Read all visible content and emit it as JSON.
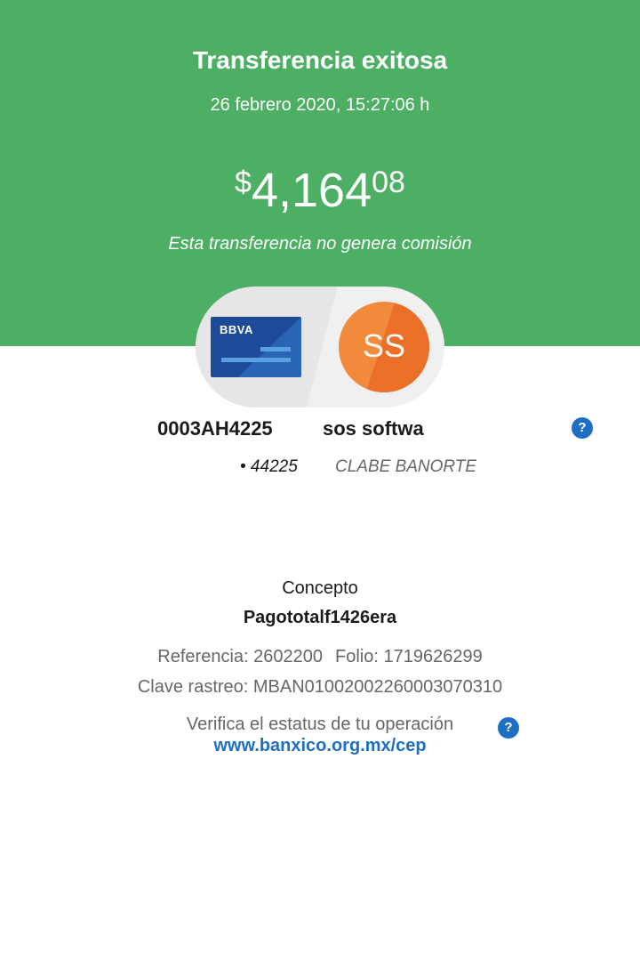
{
  "header": {
    "title": "Transferencia exitosa",
    "datetime": "26 febrero 2020, 15:27:06 h",
    "amount": {
      "currency": "$",
      "integer": "4,164",
      "decimals": "08"
    },
    "commission_note": "Esta transferencia no genera comisión",
    "background_color": "#4caf64"
  },
  "source_card": {
    "bank_logo": "BBVA",
    "icon": "bank-card-icon"
  },
  "recipient": {
    "initials": "SS",
    "account_id": "0003AH4225",
    "name": "sos softwa",
    "account_mask": "• 44225",
    "account_type": "CLABE BANORTE",
    "help_icon": "?"
  },
  "details": {
    "concept_label": "Concepto",
    "concept_value": "Pagototalf1426era",
    "reference": "Referencia: 2602200",
    "folio": "Folio: 1719626299",
    "tracking_key": "Clave rastreo: MBAN01002002260003070310",
    "verify_text": "Verifica el estatus de tu operación",
    "verify_link": "www.banxico.org.mx/cep",
    "help_icon": "?"
  },
  "colors": {
    "accent": "#1e6fc4",
    "avatar": "#f28a3c",
    "card": "#1e4a9a"
  }
}
